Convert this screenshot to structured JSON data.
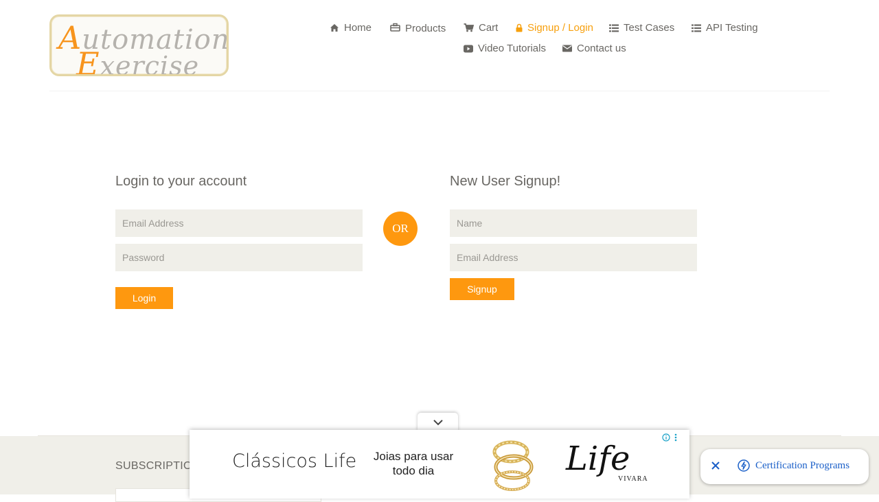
{
  "logo": {
    "line1_cap": "A",
    "line1_rest": "utomation",
    "line2_cap": "E",
    "line2_rest": "xercise"
  },
  "nav": {
    "items": [
      {
        "label": "Home",
        "icon": "home-icon"
      },
      {
        "label": "Products",
        "icon": "products-icon"
      },
      {
        "label": "Cart",
        "icon": "cart-icon"
      },
      {
        "label": "Signup / Login",
        "icon": "lock-icon",
        "active": true
      },
      {
        "label": "Test Cases",
        "icon": "list-icon"
      },
      {
        "label": "API Testing",
        "icon": "list-icon"
      },
      {
        "label": "Video Tutorials",
        "icon": "youtube-icon"
      },
      {
        "label": "Contact us",
        "icon": "envelope-icon"
      }
    ]
  },
  "login": {
    "title": "Login to your account",
    "email_placeholder": "Email Address",
    "password_placeholder": "Password",
    "button": "Login"
  },
  "or_label": "OR",
  "signup": {
    "title": "New User Signup!",
    "name_placeholder": "Name",
    "email_placeholder": "Email Address",
    "button": "Signup"
  },
  "footer": {
    "subscription_label": "SUBSCRIPTIO"
  },
  "ad": {
    "headline": "Clássicos Life",
    "subline": "Joias para usar todo dia",
    "brand_script": "Life",
    "brand_small": "VIVARA"
  },
  "cert_banner": {
    "label": "Certification Programs"
  },
  "colors": {
    "accent": "#fe980f",
    "active_nav": "#f7a00e",
    "field_bg": "#f0efe9",
    "cert_blue": "#1a5fc8"
  }
}
